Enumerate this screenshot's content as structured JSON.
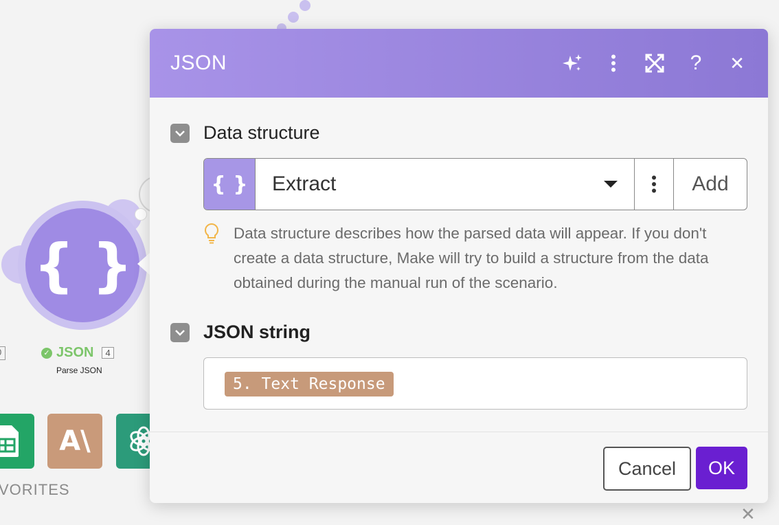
{
  "canvas": {
    "module": {
      "name": "JSON",
      "id_badge": "4",
      "subtitle": "Parse JSON",
      "status": "success",
      "icon": "curly-braces-icon"
    },
    "left_module_id_fragment": "0",
    "favorites_label": "VORITES",
    "favorites": [
      {
        "app": "Google Sheets",
        "icon": "sheets-icon"
      },
      {
        "app": "Anthropic",
        "icon": "anthropic-icon",
        "glyph": "A\\"
      },
      {
        "app": "OpenAI",
        "icon": "openai-icon"
      }
    ]
  },
  "dialog": {
    "title": "JSON",
    "header_icons": [
      "ai-sparkle-icon",
      "more-vertical-icon",
      "expand-icon",
      "help-icon",
      "close-icon"
    ],
    "help_glyph": "?",
    "close_glyph": "✕",
    "data_structure": {
      "label": "Data structure",
      "icon_glyph": "{ }",
      "selected": "Extract",
      "add_label": "Add",
      "hint": "Data structure describes how the parsed data will appear. If you don't create a data structure, Make will try to build a structure from the data obtained during the manual run of the scenario."
    },
    "json_string": {
      "label": "JSON string",
      "value_pill": "5. Text Response"
    },
    "buttons": {
      "cancel": "Cancel",
      "ok": "OK"
    }
  },
  "colors": {
    "header_start": "#a893e8",
    "header_end": "#8c78d5",
    "ok_button": "#6a1fd1",
    "pill": "#c79a7a",
    "module_green": "#7cc56a"
  }
}
